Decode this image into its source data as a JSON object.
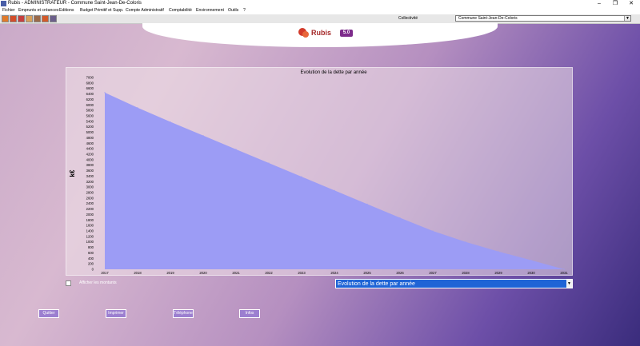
{
  "window": {
    "title": "Rubis - ADMINISTRATEUR - Commune Saint-Jean-De-Coloris",
    "controls": [
      "–",
      "❐",
      "✕"
    ]
  },
  "menu": [
    "Fichier",
    "Emprunts et créances",
    "Editions",
    "Budget Primitif et Supp.",
    "Compte Administratif",
    "Comptabilité",
    "Environnement",
    "Outils",
    "?"
  ],
  "collectivite": {
    "label": "Collectivité",
    "value": "Commune Saint-Jean-De-Coloris"
  },
  "brand": {
    "name": "Rubis",
    "version": "5.0"
  },
  "chart_data": {
    "type": "area",
    "title": "Evolution de la dette par année",
    "ylabel": "k€",
    "xlabel": "",
    "x": [
      "2017",
      "2018",
      "2019",
      "2020",
      "2021",
      "2022",
      "2023",
      "2024",
      "2025",
      "2026",
      "2027",
      "2028",
      "2029",
      "2030",
      "2031"
    ],
    "values": [
      6450,
      5900,
      5380,
      4880,
      4380,
      3880,
      3380,
      2880,
      2380,
      1880,
      1400,
      1000,
      650,
      330,
      0
    ],
    "ylim": [
      0,
      7000
    ],
    "yticks": [
      0,
      200,
      400,
      600,
      800,
      1000,
      1200,
      1400,
      1600,
      1800,
      2000,
      2200,
      2400,
      2600,
      2800,
      3000,
      3200,
      3400,
      3600,
      3800,
      4000,
      4200,
      4400,
      4600,
      4800,
      5000,
      5200,
      5400,
      5600,
      5800,
      6000,
      6200,
      6400,
      6600,
      6800,
      7000
    ],
    "fill": "#9c9cf5",
    "grid": false
  },
  "options": {
    "show_values_label": "Afficher les montants"
  },
  "chart_selector": {
    "value": "Evolution de la dette par année"
  },
  "buttons": [
    {
      "label": "Quitter"
    },
    {
      "label": "Imprimer"
    },
    {
      "label": "Téléphone"
    },
    {
      "label": "Infos"
    }
  ]
}
